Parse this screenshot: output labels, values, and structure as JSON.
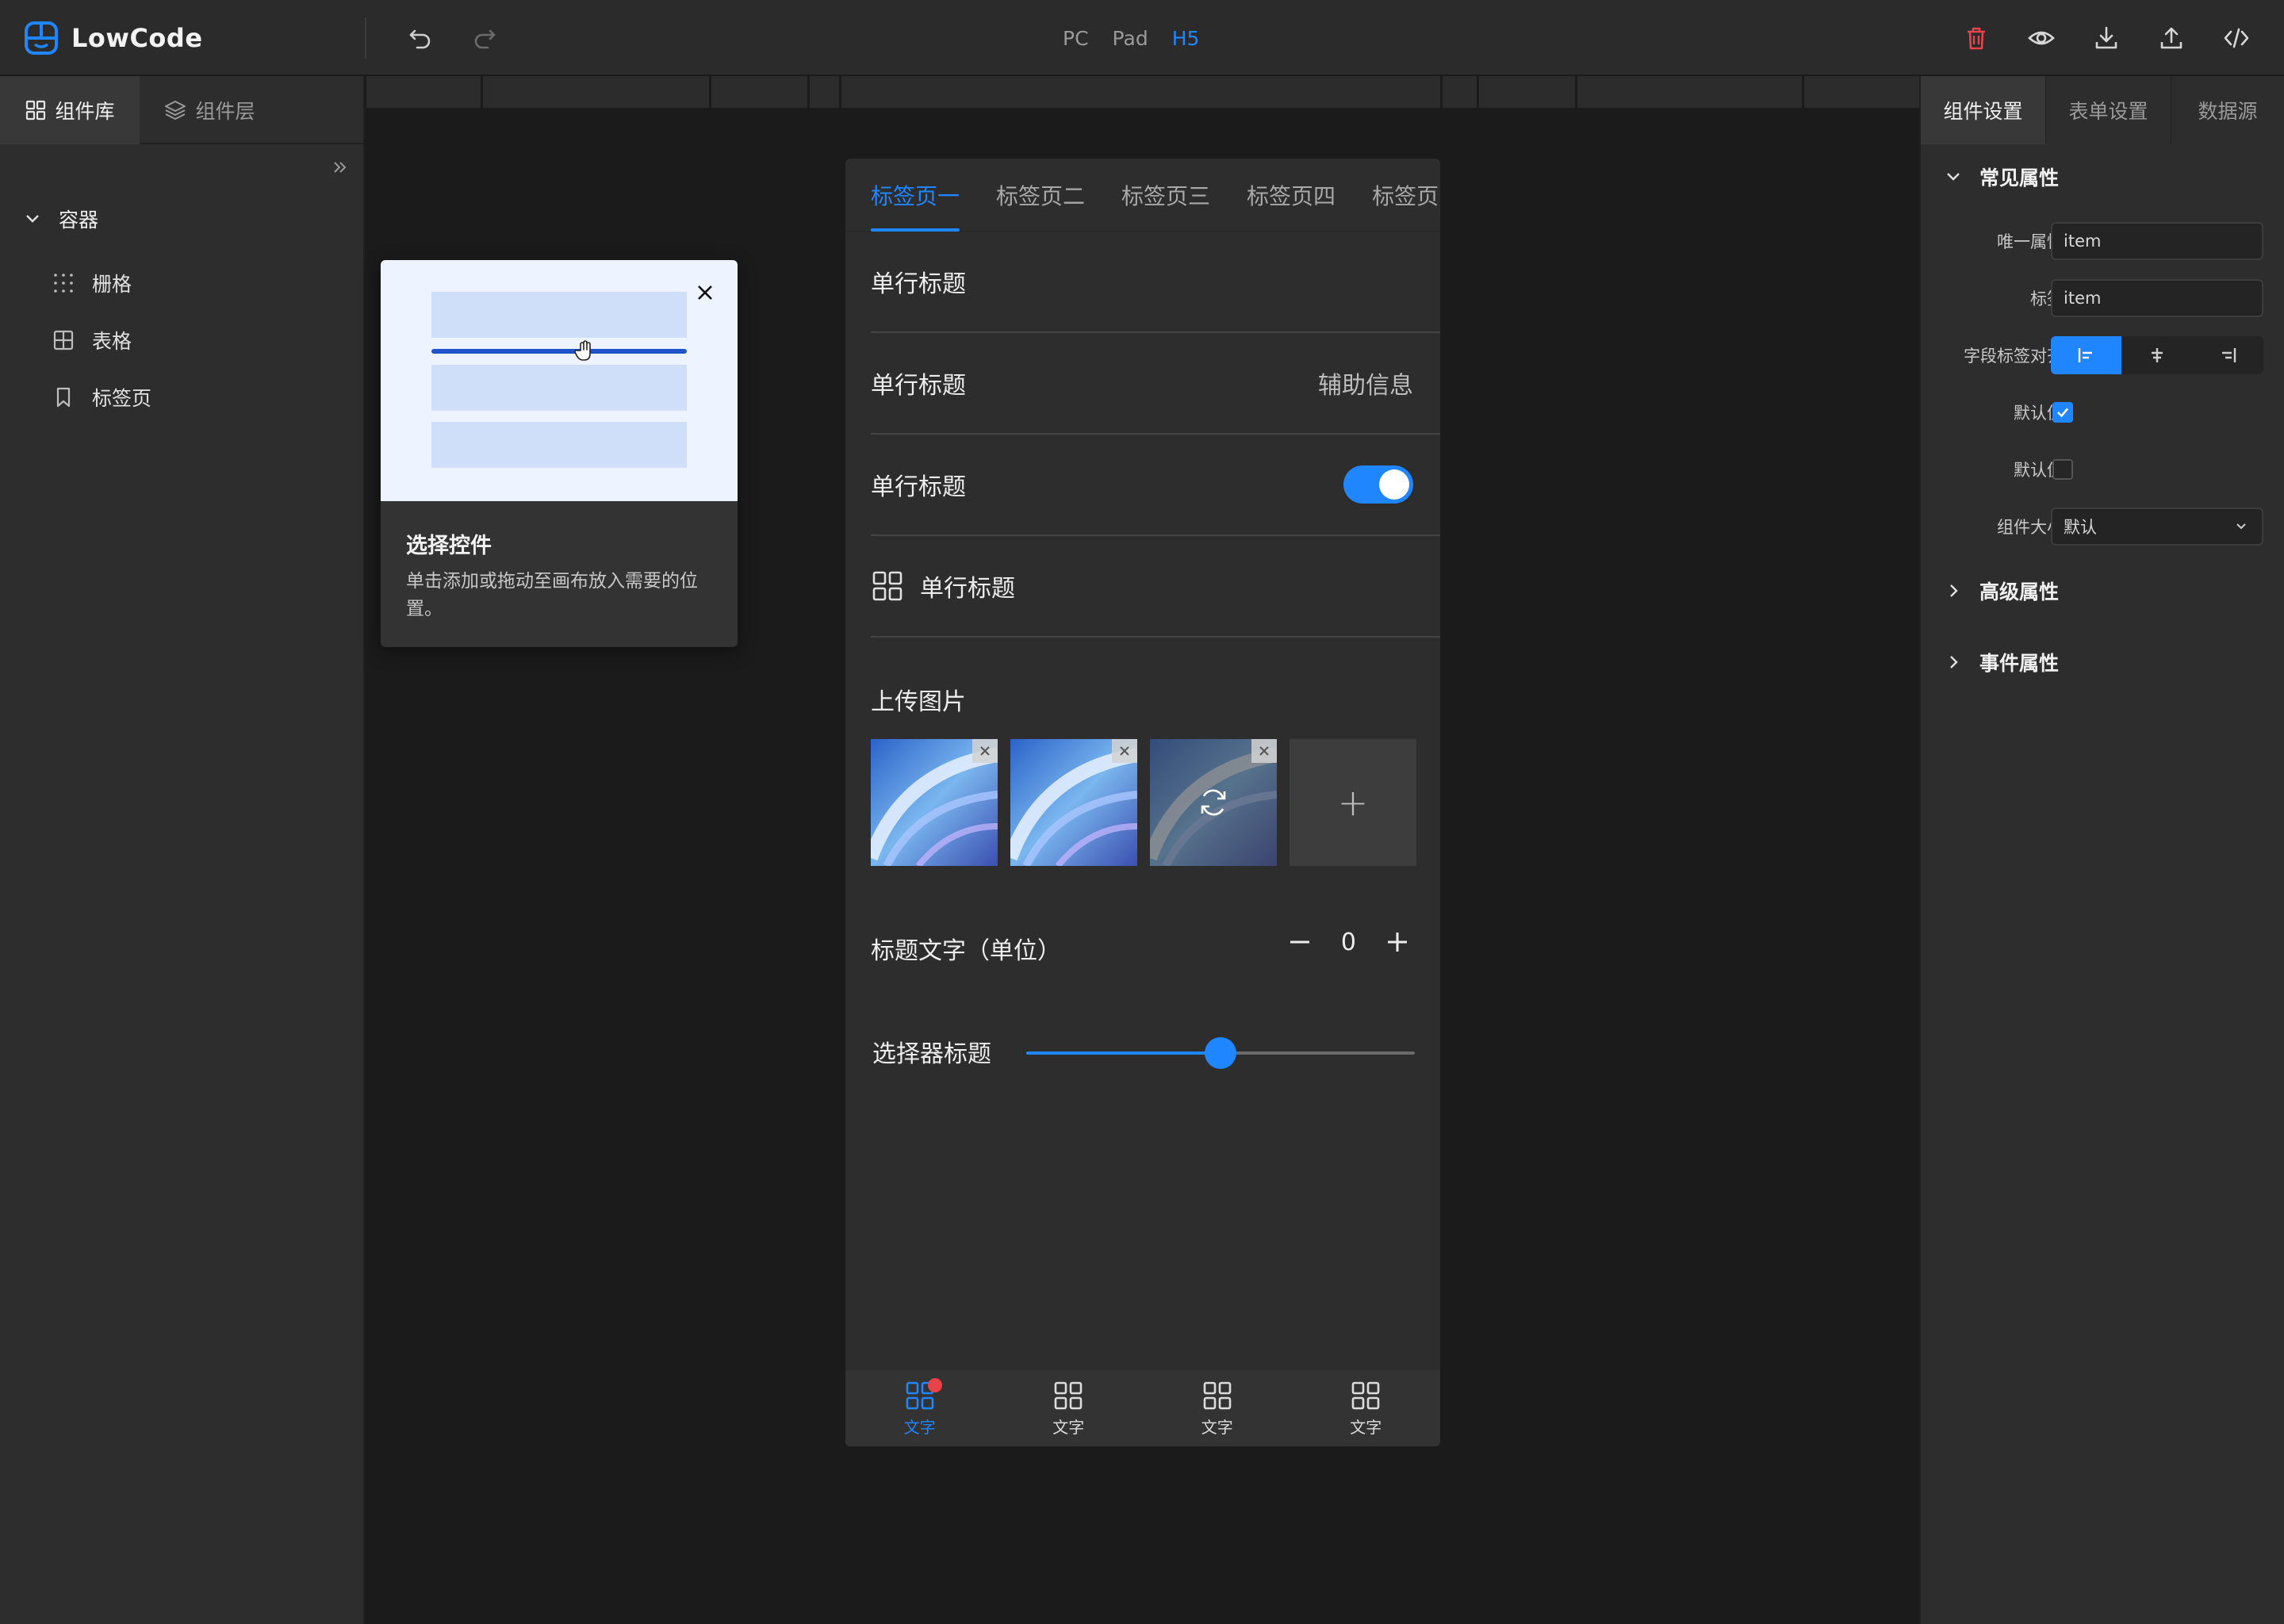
{
  "app": {
    "name": "LowCode"
  },
  "toolbar": {
    "devices": [
      "PC",
      "Pad",
      "H5"
    ],
    "active_device": "H5",
    "colors": {
      "accent": "#1f86ff",
      "danger": "#e8434b"
    }
  },
  "left_panel": {
    "tabs": [
      {
        "label": "组件库",
        "active": true
      },
      {
        "label": "组件层",
        "active": false
      }
    ],
    "group": {
      "label": "容器",
      "expanded": true
    },
    "items": [
      {
        "label": "栅格",
        "icon": "grid-dots-icon"
      },
      {
        "label": "表格",
        "icon": "table-icon"
      },
      {
        "label": "标签页",
        "icon": "bookmark-icon"
      }
    ]
  },
  "popover": {
    "title": "选择控件",
    "description": "单击添加或拖动至画布放入需要的位置。"
  },
  "phone": {
    "tabs": [
      "标签页一",
      "标签页二",
      "标签页三",
      "标签页四",
      "标签页"
    ],
    "active_tab": 0,
    "rows": [
      {
        "title": "单行标题"
      },
      {
        "title": "单行标题",
        "aux": "辅助信息"
      },
      {
        "title": "单行标题",
        "switch_on": true
      },
      {
        "title": "单行标题",
        "icon": "apps-icon"
      }
    ],
    "upload": {
      "title": "上传图片",
      "add_symbol": "+"
    },
    "stepper": {
      "label": "标题文字（单位）",
      "value": "0"
    },
    "slider": {
      "label": "选择器标题",
      "value_fraction": 0.5
    },
    "tabbar": [
      {
        "label": "文字",
        "active": true,
        "badge": true
      },
      {
        "label": "文字",
        "active": false
      },
      {
        "label": "文字",
        "active": false
      },
      {
        "label": "文字",
        "active": false
      }
    ]
  },
  "right_panel": {
    "tabs": [
      {
        "label": "组件设置",
        "active": true
      },
      {
        "label": "表单设置",
        "active": false
      },
      {
        "label": "数据源",
        "active": false
      }
    ],
    "common": {
      "title": "常见属性",
      "unique_label": "唯一属性",
      "unique_value": "item",
      "tag_label": "标签",
      "tag_value": "item",
      "align_label": "字段标签对齐",
      "default1_label": "默认值",
      "default1_checked": true,
      "default2_label": "默认值",
      "default2_checked": false,
      "size_label": "组件大小",
      "size_value": "默认"
    },
    "advanced_title": "高级属性",
    "events_title": "事件属性"
  }
}
